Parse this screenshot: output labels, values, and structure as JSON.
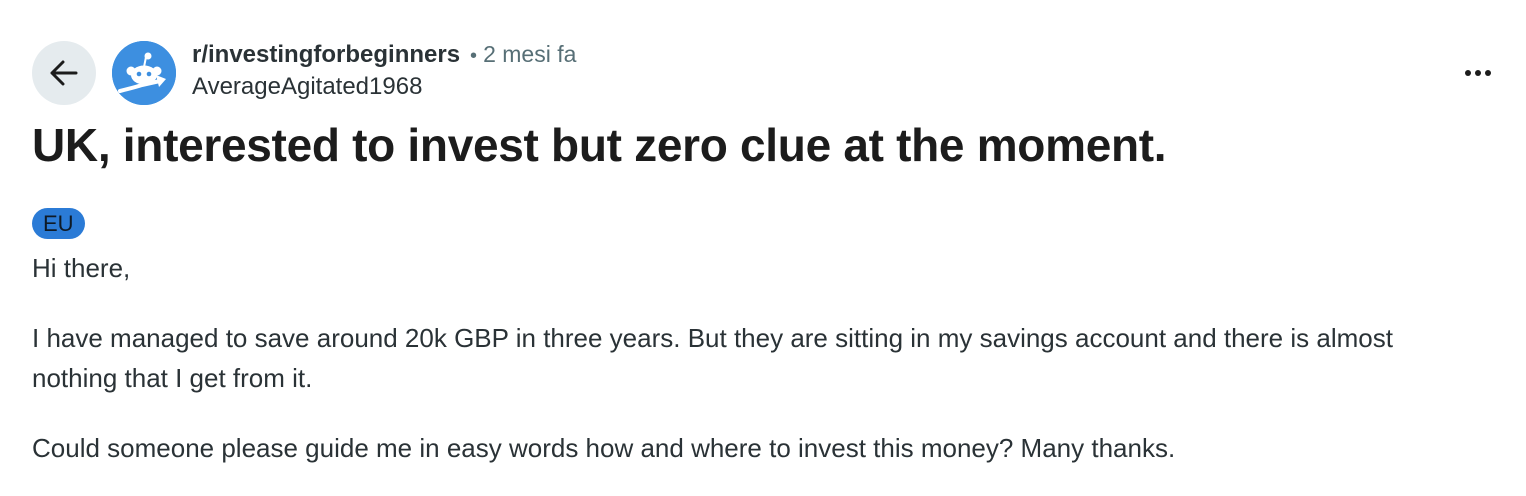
{
  "header": {
    "subreddit": "r/investingforbeginners",
    "separator": "•",
    "time_ago": "2 mesi fa",
    "author": "AverageAgitated1968",
    "icons": {
      "back": "arrow-left-icon",
      "avatar": "subreddit-avatar-icon",
      "more": "more-options-icon"
    }
  },
  "post": {
    "title": "UK, interested to invest but zero clue at the moment.",
    "flair": "EU",
    "paragraphs": [
      "Hi there,",
      "I have managed to save around 20k GBP in three years. But they are sitting in my savings account and there is almost nothing that I get from it.",
      "Could someone please guide me in easy words how and where to invest this money? Many thanks."
    ]
  },
  "colors": {
    "back_button_bg": "#e5ebee",
    "avatar_bg": "#3d8fe0",
    "flair_bg": "#2b7bd6",
    "meta_gray": "#576f76",
    "text": "#1c1c1c"
  }
}
